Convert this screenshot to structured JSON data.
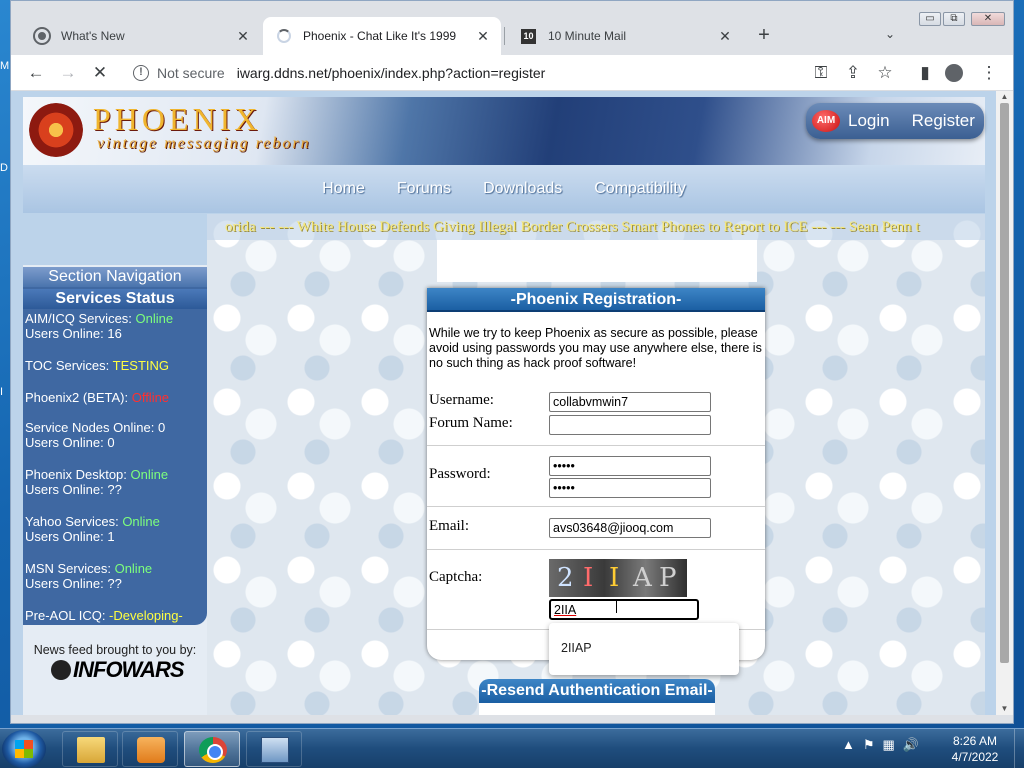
{
  "desktop": {
    "side_letters": [
      "M",
      "D",
      "I"
    ]
  },
  "window_controls": {
    "minimize": "▭",
    "restore": "⧉",
    "close": "✕"
  },
  "tabs": [
    {
      "title": "What's New",
      "close": "✕"
    },
    {
      "title": "Phoenix - Chat Like It's 1999",
      "close": "✕"
    },
    {
      "title": "10 Minute Mail",
      "close": "✕"
    }
  ],
  "tab_icons": [
    "chrome-icon",
    "loading-spinner-icon",
    "ten-minute-mail-icon"
  ],
  "ten_minute_mail_favicon": "10",
  "new_tab": "+",
  "tab_search": "⌄",
  "nav": {
    "back": "←",
    "forward": "→",
    "reload": "✕"
  },
  "omnibox": {
    "security_label": "Not secure",
    "url": "iwarg.ddns.net/phoenix/index.php?action=register"
  },
  "toolbar_icons": {
    "key": "⚿",
    "share": "⇪",
    "bookmark": "☆",
    "side_panel": "▮",
    "menu": "⋮"
  },
  "site": {
    "logo_title": "PHOENIX",
    "logo_tagline": "vintage messaging reborn",
    "aim_badge": "AIM",
    "login": "Login",
    "register": "Register",
    "nav_links": [
      "Home",
      "Forums",
      "Downloads",
      "Compatibility"
    ],
    "ticker": "orida --- --- White House Defends Giving Illegal Border Crossers Smart Phones to Report to ICE --- --- Sean Penn t"
  },
  "sidebar": {
    "section_nav": "Section Navigation",
    "services_status": "Services Status",
    "services": [
      {
        "name": "AIM/ICQ Services: ",
        "status": "Online",
        "status_class": "online",
        "users": "Users Online: 16"
      },
      {
        "name": "TOC Services: ",
        "status": "TESTING",
        "status_class": "testing",
        "users": ""
      },
      {
        "name": "Phoenix2 (BETA): ",
        "status": "Offline",
        "status_class": "offline",
        "users": ""
      },
      {
        "name": "Service Nodes Online: 0",
        "status": "",
        "status_class": "",
        "users": "Users Online: 0"
      },
      {
        "name": "Phoenix Desktop: ",
        "status": "Online",
        "status_class": "online",
        "users": "Users Online: ??"
      },
      {
        "name": "Yahoo Services: ",
        "status": "Online",
        "status_class": "online",
        "users": "Users Online: 1"
      },
      {
        "name": "MSN Services: ",
        "status": "Online",
        "status_class": "online",
        "users": "Users Online: ??"
      },
      {
        "name": "Pre-AOL ICQ: ",
        "status": "-Developing-",
        "status_class": "dev",
        "users": ""
      }
    ],
    "newsfeed_label": "News feed brought to you by:",
    "newsfeed_brand": "INFOWARS"
  },
  "registration": {
    "title": "-Phoenix Registration-",
    "intro": "While we try to keep Phoenix as secure as possible, please avoid using passwords you may use anywhere else, there is no such thing as hack proof software!",
    "labels": {
      "username": "Username:",
      "forum_name": "Forum Name:",
      "password": "Password:",
      "email": "Email:",
      "captcha": "Captcha:"
    },
    "values": {
      "username": "collabvmwin7",
      "forum_name": "",
      "password": "•••••",
      "password_confirm": "•••••",
      "email": "avs03648@jiooq.com",
      "captcha": "2IIA"
    },
    "captcha_chars": [
      "2",
      "I",
      "I",
      "A",
      "P"
    ],
    "autocomplete_option": "2IIAP"
  },
  "resend": {
    "title": "-Resend Authentication Email-"
  },
  "taskbar": {
    "buttons": [
      "explorer",
      "media-player",
      "chrome",
      "remote-desktop"
    ],
    "tray": {
      "chevron": "▲",
      "flag": "⚑",
      "network": "▦",
      "volume": "🔊"
    },
    "time": "8:26 AM",
    "date": "4/7/2022"
  },
  "colors": {
    "online": "#7dff7d",
    "testing": "#ffff40",
    "offline": "#ff3030",
    "panel": "#3f68a2",
    "accent": "#1b5fa3"
  }
}
